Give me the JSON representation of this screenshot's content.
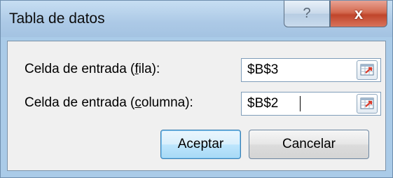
{
  "dialog": {
    "title": "Tabla de datos",
    "help_glyph": "?",
    "close_glyph": "x"
  },
  "row_input": {
    "label_pre": "Celda de entrada (",
    "label_key": "f",
    "label_post": "ila):",
    "value": "$B$3"
  },
  "column_input": {
    "label_pre": "Celda de entrada (",
    "label_key": "c",
    "label_post": "olumna):",
    "value": "$B$2"
  },
  "buttons": {
    "ok": "Aceptar",
    "cancel": "Cancelar"
  },
  "colors": {
    "frame": "#aacbe8",
    "close": "#c7472e",
    "ref_icon_red": "#d93a2a"
  }
}
